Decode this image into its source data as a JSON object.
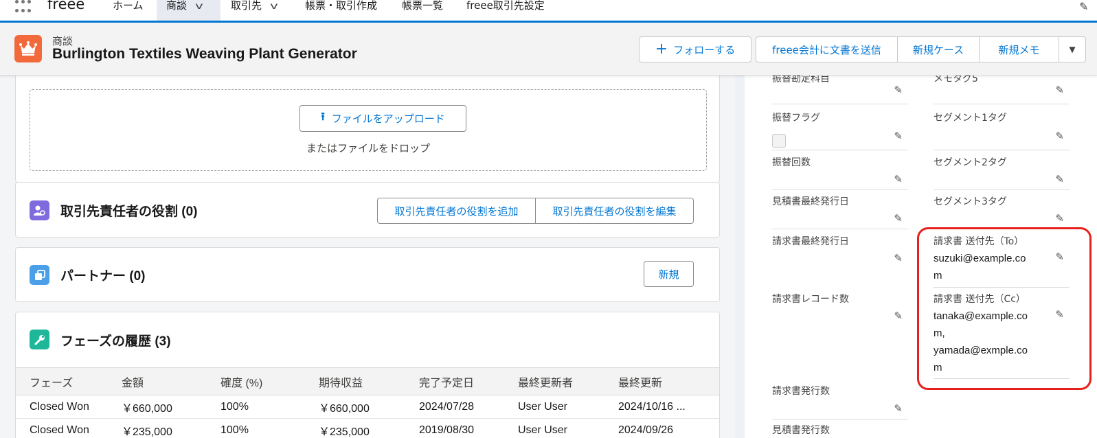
{
  "app": {
    "name": "freee"
  },
  "nav": {
    "tabs": [
      {
        "label": "ホーム"
      },
      {
        "label": "商談"
      },
      {
        "label": "取引先"
      },
      {
        "label": "帳票・取引作成"
      },
      {
        "label": "帳票一覧"
      },
      {
        "label": "freee取引先設定"
      }
    ]
  },
  "record": {
    "object_label": "商談",
    "title": "Burlington Textiles Weaving Plant Generator",
    "icon_color": "#f26a3c",
    "buttons": {
      "follow": "フォローする",
      "send": "freee会計に文書を送信",
      "new_case": "新規ケース",
      "new_memo": "新規メモ"
    }
  },
  "files": {
    "upload_label": "ファイルをアップロード",
    "drop_text": "またはファイルをドロップ"
  },
  "contact_roles": {
    "title": "取引先責任者の役割 (0)",
    "add_label": "取引先責任者の役割を追加",
    "edit_label": "取引先責任者の役割を編集"
  },
  "partners": {
    "title": "パートナー (0)",
    "new_label": "新規"
  },
  "phase_history": {
    "title": "フェーズの履歴 (3)",
    "columns": [
      "フェーズ",
      "金額",
      "確度 (%)",
      "期待収益",
      "完了予定日",
      "最終更新者",
      "最終更新"
    ],
    "rows": [
      [
        "Closed Won",
        "￥660,000",
        "100%",
        "￥660,000",
        "2024/07/28",
        "User User",
        "2024/10/16 ..."
      ],
      [
        "Closed Won",
        "￥235,000",
        "100%",
        "￥235,000",
        "2019/08/30",
        "User User",
        "2024/09/26"
      ]
    ]
  },
  "fields": {
    "left": [
      {
        "label": "振替勘定科目",
        "value": ""
      },
      {
        "label": "振替フラグ",
        "value": ""
      },
      {
        "label": "振替回数",
        "value": ""
      },
      {
        "label": "見積書最終発行日",
        "value": ""
      },
      {
        "label": "請求書最終発行日",
        "value": ""
      },
      {
        "label": "請求書レコード数",
        "value": ""
      },
      {
        "label": "請求書発行数",
        "value": ""
      },
      {
        "label": "見積書発行数",
        "value": ""
      }
    ],
    "right": [
      {
        "label": "メモタグ5",
        "value": ""
      },
      {
        "label": "セグメント1タグ",
        "value": ""
      },
      {
        "label": "セグメント2タグ",
        "value": ""
      },
      {
        "label": "セグメント3タグ",
        "value": ""
      },
      {
        "label": "請求書 送付先（To）",
        "value_lines": [
          "suzuki@example.co",
          "m"
        ]
      },
      {
        "label": "請求書 送付先（Cc）",
        "value_lines": [
          "tanaka@example.co",
          "m,",
          "yamada@exmple.co",
          "m"
        ]
      }
    ]
  },
  "colors": {
    "brand": "#0176d3",
    "highlight": "#e8201c"
  }
}
